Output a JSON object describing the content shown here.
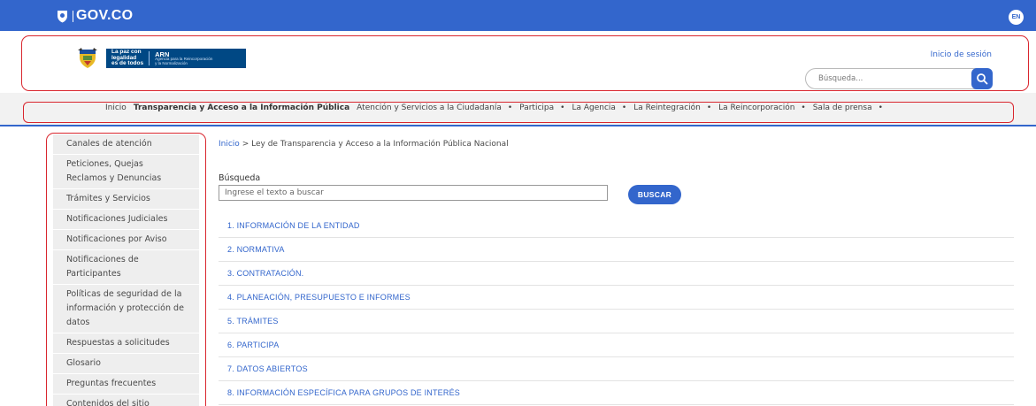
{
  "topbar": {
    "brand": "GOV.CO",
    "lang": "EN"
  },
  "header": {
    "logo_line1": "La paz con",
    "logo_line2": "legalidad",
    "logo_line3": "es de todos",
    "arn_title": "ARN",
    "arn_sub1": "Agencia para la Reincorporación",
    "arn_sub2": "y la Normalización",
    "login": "Inicio de sesión",
    "search_placeholder": "Búsqueda..."
  },
  "nav": {
    "items": [
      {
        "label": "Inicio",
        "bold": false,
        "dropdown": false
      },
      {
        "label": "Transparencia y Acceso a la Información Pública",
        "bold": true,
        "dropdown": false
      },
      {
        "label": "Atención y Servicios a la Ciudadanía",
        "bold": false,
        "dropdown": true
      },
      {
        "label": "Participa",
        "bold": false,
        "dropdown": true
      },
      {
        "label": "La Agencia",
        "bold": false,
        "dropdown": true
      },
      {
        "label": "La Reintegración",
        "bold": false,
        "dropdown": true
      },
      {
        "label": "La Reincorporación",
        "bold": false,
        "dropdown": true
      },
      {
        "label": "Sala de prensa",
        "bold": false,
        "dropdown": true
      }
    ],
    "dropdown_marker": "•"
  },
  "sidebar": {
    "items": [
      "Canales de atención",
      "Peticiones, Quejas Reclamos y Denuncias",
      "Trámites y Servicios",
      "Notificaciones Judiciales",
      "Notificaciones por Aviso",
      "Notificaciones de Participantes",
      "Políticas de seguridad de la información y protección de datos",
      "Respuestas a solicitudes",
      "Glosario",
      "Preguntas frecuentes",
      "Contenidos del sitio"
    ]
  },
  "main": {
    "breadcrumb_home": "Inicio",
    "breadcrumb_sep": ">",
    "breadcrumb_current": "Ley de Transparencia y Acceso a la Información Pública Nacional",
    "search_label": "Búsqueda",
    "search_placeholder": "Ingrese el texto a buscar",
    "search_button": "BUSCAR",
    "sections": [
      "1. INFORMACIÓN DE LA ENTIDAD",
      "2. NORMATIVA",
      "3. CONTRATACIÓN.",
      "4. PLANEACIÓN, PRESUPUESTO E INFORMES",
      "5. TRÁMITES",
      "6. PARTICIPA",
      "7. DATOS ABIERTOS",
      "8. INFORMACIÓN ESPECÍFICA PARA GRUPOS DE INTERÉS"
    ]
  },
  "colors": {
    "gov_blue": "#3366cc",
    "highlight_red": "#d9262e",
    "sidebar_bg": "#eeeeee",
    "nav_bg": "#f2f2f2"
  }
}
